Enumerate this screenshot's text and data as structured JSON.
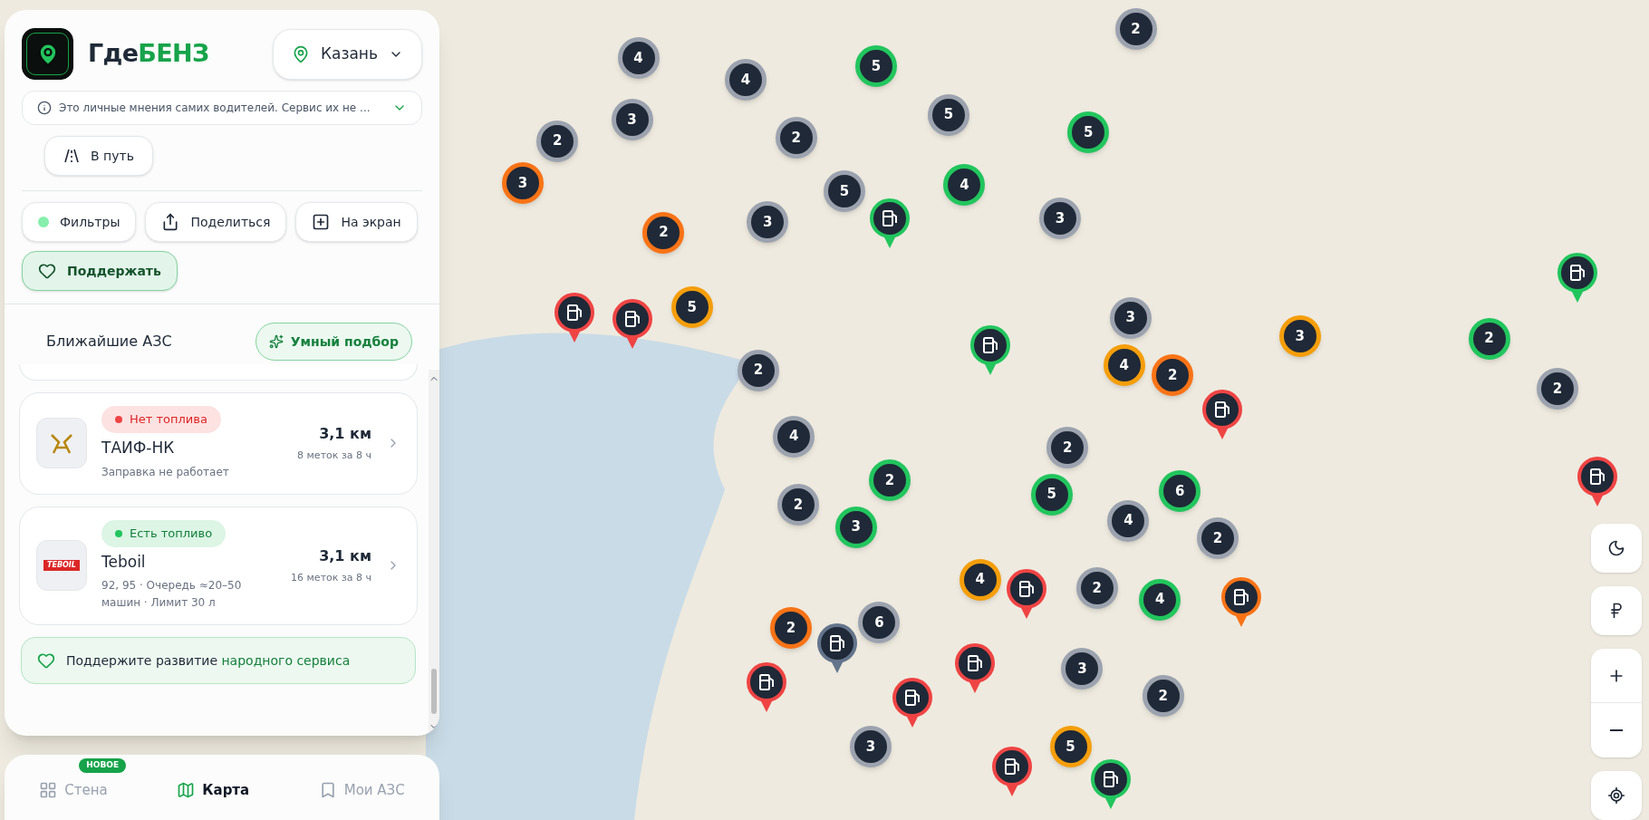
{
  "app": {
    "name_part_1": "Где",
    "name_part_2": "БЕНЗ"
  },
  "city": {
    "label": "Казань"
  },
  "notice": {
    "text": "Это личные мнения самих водителей. Сервис их не ...",
    "expanded": false
  },
  "route_button": "В путь",
  "actions": [
    {
      "kind": "filters",
      "label": "Фильтры",
      "active": true
    },
    {
      "kind": "share",
      "label": "Поделиться"
    },
    {
      "kind": "add_screen",
      "label": "На экран"
    },
    {
      "kind": "support",
      "label": "Поддержать"
    }
  ],
  "nearby": {
    "title": "Ближайшие АЗС",
    "smart_button": "Умный подбор"
  },
  "stations": [
    {
      "has_fuel": false,
      "status_label": "Нет топлива",
      "name": "ТАИФ-НК",
      "details": "Заправка не работает",
      "distance": "3,1 км",
      "marks": "8 меток за 8 ч"
    },
    {
      "logo_text": "TEBOIL",
      "has_fuel": true,
      "status_label": "Есть топливо",
      "name": "Teboil",
      "details": "92, 95 · Очередь ≈20–50 машин · Лимит 30 л",
      "distance": "3,1 км",
      "marks": "16 меток за 8 ч"
    }
  ],
  "support_banner": "Поддержите развитие **народного сервиса**",
  "bottom_nav": [
    {
      "label": "Стена",
      "badge": "НОВОЕ",
      "selected": false
    },
    {
      "label": "Карта",
      "selected": true
    },
    {
      "label": "Мои АЗС",
      "selected": false
    }
  ],
  "map": {
    "markers": [
      {
        "kind": "cluster",
        "count": "4",
        "color": "#9ca3af"
      },
      {
        "kind": "cluster",
        "count": "4",
        "color": "#9ca3af"
      },
      {
        "kind": "cluster",
        "count": "5",
        "color": "#22c55e"
      },
      {
        "kind": "cluster",
        "count": "2",
        "color": "#9ca3af"
      },
      {
        "kind": "cluster",
        "count": "3",
        "color": "#9ca3af"
      },
      {
        "kind": "cluster",
        "count": "2",
        "color": "#9ca3af"
      },
      {
        "kind": "cluster",
        "count": "2",
        "color": "#9ca3af"
      },
      {
        "kind": "cluster",
        "count": "5",
        "color": "#9ca3af"
      },
      {
        "kind": "cluster",
        "count": "5",
        "color": "#22c55e"
      },
      {
        "kind": "cluster",
        "count": "3",
        "color": "#f97316"
      },
      {
        "kind": "cluster",
        "count": "5",
        "color": "#9ca3af"
      },
      {
        "kind": "cluster",
        "count": "4",
        "color": "#22c55e"
      },
      {
        "kind": "cluster",
        "count": "3",
        "color": "#9ca3af"
      },
      {
        "kind": "cluster",
        "count": "2",
        "color": "#f97316"
      },
      {
        "kind": "cluster",
        "count": "3",
        "color": "#9ca3af"
      },
      {
        "kind": "cluster",
        "count": "5",
        "color": "#f59e0b"
      },
      {
        "kind": "cluster",
        "count": "3",
        "color": "#9ca3af"
      },
      {
        "kind": "cluster",
        "count": "3",
        "color": "#f59e0b"
      },
      {
        "kind": "cluster",
        "count": "2",
        "color": "#22c55e"
      },
      {
        "kind": "cluster",
        "count": "2",
        "color": "#9ca3af"
      },
      {
        "kind": "cluster",
        "count": "4",
        "color": "#f59e0b"
      },
      {
        "kind": "cluster",
        "count": "2",
        "color": "#f97316"
      },
      {
        "kind": "cluster",
        "count": "2",
        "color": "#9ca3af"
      },
      {
        "kind": "cluster",
        "count": "4",
        "color": "#9ca3af"
      },
      {
        "kind": "cluster",
        "count": "2",
        "color": "#9ca3af"
      },
      {
        "kind": "cluster",
        "count": "2",
        "color": "#22c55e"
      },
      {
        "kind": "cluster",
        "count": "2",
        "color": "#9ca3af"
      },
      {
        "kind": "cluster",
        "count": "5",
        "color": "#22c55e"
      },
      {
        "kind": "cluster",
        "count": "6",
        "color": "#22c55e"
      },
      {
        "kind": "cluster",
        "count": "3",
        "color": "#22c55e"
      },
      {
        "kind": "cluster",
        "count": "4",
        "color": "#9ca3af"
      },
      {
        "kind": "cluster",
        "count": "2",
        "color": "#9ca3af"
      },
      {
        "kind": "cluster",
        "count": "4",
        "color": "#f59e0b"
      },
      {
        "kind": "cluster",
        "count": "2",
        "color": "#9ca3af"
      },
      {
        "kind": "cluster",
        "count": "4",
        "color": "#22c55e"
      },
      {
        "kind": "cluster",
        "count": "2",
        "color": "#f97316"
      },
      {
        "kind": "cluster",
        "count": "6",
        "color": "#9ca3af"
      },
      {
        "kind": "cluster",
        "count": "3",
        "color": "#9ca3af"
      },
      {
        "kind": "cluster",
        "count": "2",
        "color": "#9ca3af"
      },
      {
        "kind": "cluster",
        "count": "3",
        "color": "#9ca3af"
      },
      {
        "kind": "cluster",
        "count": "5",
        "color": "#f59e0b"
      },
      {
        "kind": "pin",
        "color": "#22c55e"
      },
      {
        "kind": "pin",
        "color": "#ef4444"
      },
      {
        "kind": "pin",
        "color": "#ef4444"
      },
      {
        "kind": "pin",
        "color": "#22c55e"
      },
      {
        "kind": "pin",
        "color": "#22c55e"
      },
      {
        "kind": "pin",
        "color": "#ef4444"
      },
      {
        "kind": "pin",
        "color": "#ef4444"
      },
      {
        "kind": "pin",
        "color": "#ef4444"
      },
      {
        "kind": "pin",
        "color": "#f97316"
      },
      {
        "kind": "pin",
        "color": "#64748b"
      },
      {
        "kind": "pin",
        "color": "#ef4444"
      },
      {
        "kind": "pin",
        "color": "#ef4444"
      },
      {
        "kind": "pin",
        "color": "#ef4444"
      },
      {
        "kind": "pin",
        "color": "#ef4444"
      },
      {
        "kind": "pin",
        "color": "#22c55e"
      }
    ]
  }
}
